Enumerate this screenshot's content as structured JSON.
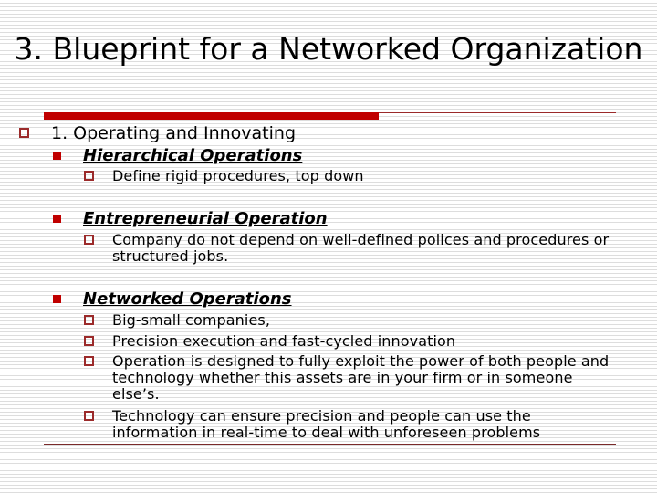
{
  "slide": {
    "title": "3. Blueprint for a Networked Organization",
    "colors": {
      "accent": "#c00000",
      "bullet_outline": "#9b2a2a",
      "stripe": "#dddddd",
      "text": "#000000"
    },
    "outline": {
      "level1": {
        "icon": "hollow-square-bullet-icon",
        "text": "1. Operating and Innovating"
      },
      "sections": [
        {
          "icon": "solid-square-bullet-icon",
          "heading": "Hierarchical Operations",
          "points": [
            "Define rigid procedures, top down"
          ]
        },
        {
          "icon": "solid-square-bullet-icon",
          "heading": "Entrepreneurial Operation",
          "points": [
            "Company do not depend on well-defined polices and procedures or structured jobs."
          ]
        },
        {
          "icon": "solid-square-bullet-icon",
          "heading": "Networked Operations",
          "points": [
            "Big-small companies,",
            "Precision execution and fast-cycled innovation",
            "Operation is designed to fully exploit the power of both people and technology whether this assets are in your firm or in someone else’s.",
            "Technology can ensure precision and people can use the information in real-time to deal with unforeseen problems"
          ]
        }
      ]
    }
  }
}
